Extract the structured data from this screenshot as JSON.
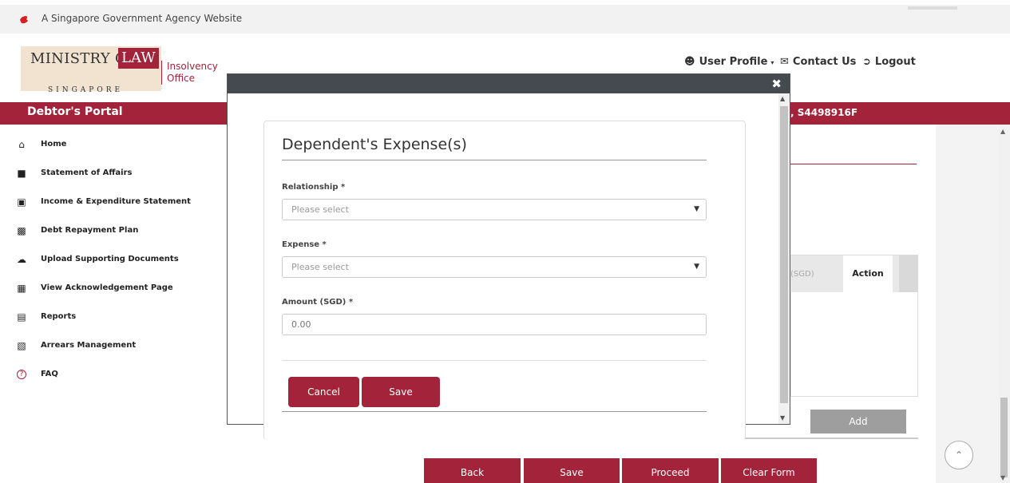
{
  "gov_banner": {
    "text": "A Singapore Government Agency Website"
  },
  "logo": {
    "ministry": "MINISTRY OF",
    "law": "LAW",
    "country": "SINGAPORE",
    "office": "Insolvency Office"
  },
  "topnav": {
    "user_profile": "User Profile",
    "contact_us": "Contact Us",
    "logout": "Logout"
  },
  "portal": {
    "title": "Debtor's Portal",
    "user_id": ", S4498916F"
  },
  "sidebar": {
    "items": [
      {
        "label": "Home",
        "icon": "home-icon"
      },
      {
        "label": "Statement of Affairs",
        "icon": "folder-icon"
      },
      {
        "label": "Income & Expenditure Statement",
        "icon": "book-icon"
      },
      {
        "label": "Debt Repayment Plan",
        "icon": "money-icon"
      },
      {
        "label": "Upload Supporting Documents",
        "icon": "cloud-upload-icon"
      },
      {
        "label": "View Acknowledgement Page",
        "icon": "document-icon"
      },
      {
        "label": "Reports",
        "icon": "report-icon"
      },
      {
        "label": "Arrears Management",
        "icon": "clipboard-icon"
      },
      {
        "label": "FAQ",
        "icon": "question-icon"
      }
    ]
  },
  "background": {
    "table_header_partial": "(SGD)",
    "table_header_action": "Action",
    "add_label": "Add",
    "buttons": {
      "back": "Back",
      "save": "Save",
      "proceed": "Proceed",
      "clear": "Clear Form"
    }
  },
  "modal": {
    "close": "✖",
    "title": "Dependent's Expense(s)",
    "relationship": {
      "label": "Relationship *",
      "value": "Please select"
    },
    "expense": {
      "label": "Expense *",
      "value": "Please select"
    },
    "amount": {
      "label": "Amount (SGD) *",
      "placeholder": "0.00"
    },
    "cancel": "Cancel",
    "save": "Save"
  },
  "colors": {
    "brand": "#a3243a",
    "modal_bar": "#444a50",
    "disabled_button": "#9e9e9e"
  }
}
